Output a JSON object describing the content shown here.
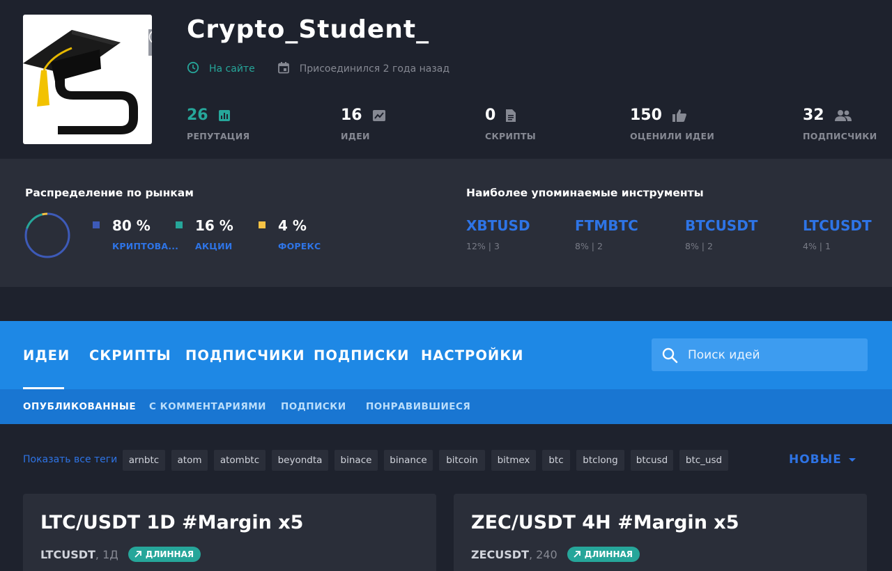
{
  "profile": {
    "username": "Crypto_Student_",
    "online_status": "На сайте",
    "joined": "Присоединился 2 года назад",
    "stats": [
      {
        "value": "26",
        "label": "РЕПУТАЦИЯ"
      },
      {
        "value": "16",
        "label": "ИДЕИ"
      },
      {
        "value": "0",
        "label": "СКРИПТЫ"
      },
      {
        "value": "150",
        "label": "ОЦЕНИЛИ ИДЕИ"
      },
      {
        "value": "32",
        "label": "ПОДПИСЧИКИ"
      }
    ],
    "avatar_letter": "S"
  },
  "market_distribution": {
    "title": "Распределение по рынкам",
    "items": [
      {
        "percent": "80 %",
        "name": "КРИПТОВА...",
        "color": "#3d5ab8",
        "fraction": 0.8
      },
      {
        "percent": "16 %",
        "name": "АКЦИИ",
        "color": "#26a69a",
        "fraction": 0.16
      },
      {
        "percent": "4 %",
        "name": "ФОРЕКС",
        "color": "#f6c244",
        "fraction": 0.04
      }
    ]
  },
  "instruments": {
    "title": "Наиболее упоминаемые инструменты",
    "items": [
      {
        "symbol": "XBTUSD",
        "meta": "12% | 3"
      },
      {
        "symbol": "FTMBTC",
        "meta": "8% | 2"
      },
      {
        "symbol": "BTCUSDT",
        "meta": "8% | 2"
      },
      {
        "symbol": "LTCUSDT",
        "meta": "4% | 1"
      }
    ]
  },
  "nav": {
    "tabs": [
      "ИДЕИ",
      "СКРИПТЫ",
      "ПОДПИСЧИКИ",
      "ПОДПИСКИ",
      "НАСТРОЙКИ"
    ],
    "search_placeholder": "Поиск идей",
    "subtabs": [
      "ОПУБЛИКОВАННЫЕ",
      "С КОММЕНТАРИЯМИ",
      "ПОДПИСКИ",
      "ПОНРАВИВШИЕСЯ"
    ]
  },
  "tags": {
    "label": "Показать все теги",
    "items": [
      "arnbtc",
      "atom",
      "atombtc",
      "beyondta",
      "binace",
      "binance",
      "bitcoin",
      "bitmex",
      "btc",
      "btclong",
      "btcusd",
      "btc_usd"
    ],
    "sort_label": "НОВЫЕ"
  },
  "ideas": [
    {
      "title": "LTC/USDT 1D #Margin x5",
      "symbol": "LTCUSDT",
      "timeframe": ", 1Д",
      "badge": "ДЛИННАЯ"
    },
    {
      "title": "ZEC/USDT 4H #Margin x5",
      "symbol": "ZECUSDT",
      "timeframe": ", 240",
      "badge": "ДЛИННАЯ"
    }
  ],
  "colors": {
    "accent_blue": "#1e88e5",
    "link_blue": "#2e74e6",
    "teal": "#26a69a"
  }
}
